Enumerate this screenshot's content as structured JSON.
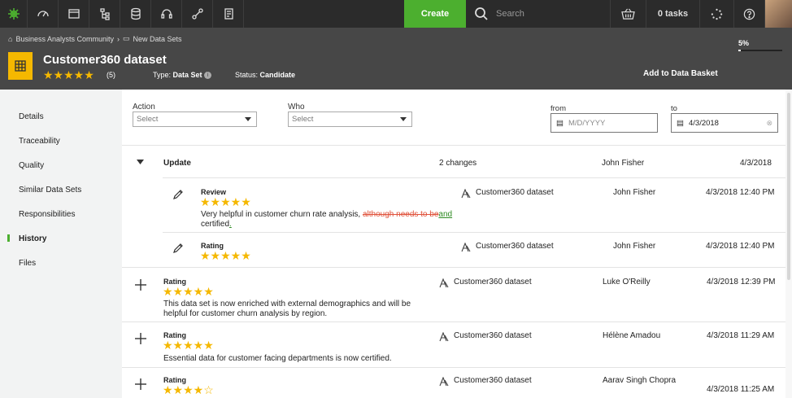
{
  "topbar": {
    "create_label": "Create",
    "search_placeholder": "Search",
    "tasks_label": "0 tasks"
  },
  "header": {
    "breadcrumb": [
      "Business Analysts Community",
      "New Data Sets"
    ],
    "title": "Customer360 dataset",
    "rating_stars": "★★★★★",
    "rating_count": "(5)",
    "type_label": "Type:",
    "type_value": "Data Set",
    "status_label": "Status:",
    "status_value": "Candidate",
    "add_basket": "Add to Data Basket",
    "progress_label": "5%",
    "progress_value": 0.05
  },
  "sidebar": {
    "items": [
      "Details",
      "Traceability",
      "Quality",
      "Similar Data Sets",
      "Responsibilities",
      "History",
      "Files"
    ],
    "active": "History"
  },
  "filters": {
    "action_label": "Action",
    "action_value": "Select",
    "who_label": "Who",
    "who_value": "Select",
    "from_label": "from",
    "from_placeholder": "M/D/YYYY",
    "to_label": "to",
    "to_value": "4/3/2018"
  },
  "history": {
    "group": {
      "title": "Update",
      "changes": "2 changes",
      "user": "John Fisher",
      "date": "4/3/2018",
      "items": [
        {
          "type": "Review",
          "stars": "★★★★★",
          "text_before": "Very helpful in customer churn rate analysis, ",
          "text_deleted": "although needs to be",
          "text_inserted": "and",
          "text_after": "certified",
          "text_inserted_end": ".",
          "asset": "Customer360 dataset",
          "user": "John Fisher",
          "date": "4/3/2018 12:40 PM"
        },
        {
          "type": "Rating",
          "stars": "★★★★★",
          "asset": "Customer360 dataset",
          "user": "John Fisher",
          "date": "4/3/2018 12:40 PM"
        }
      ]
    },
    "rows": [
      {
        "type": "Rating",
        "stars": "★★★★★",
        "text_line1": "This data set is now enriched with external demographics and will be",
        "text_line2": "helpful for customer churn analysis by region.",
        "asset": "Customer360 dataset",
        "user": "Luke O'Reilly",
        "date": "4/3/2018 12:39 PM"
      },
      {
        "type": "Rating",
        "stars": "★★★★★",
        "text_line1": "Essential data for customer facing departments is now certified.",
        "asset": "Customer360 dataset",
        "user": "Hélène Amadou",
        "date": "4/3/2018 11:29 AM"
      },
      {
        "type": "Rating",
        "stars": "★★★★☆",
        "asset": "Customer360 dataset",
        "user": "Aarav Singh Chopra",
        "date": "4/3/2018 11:25 AM"
      }
    ]
  }
}
